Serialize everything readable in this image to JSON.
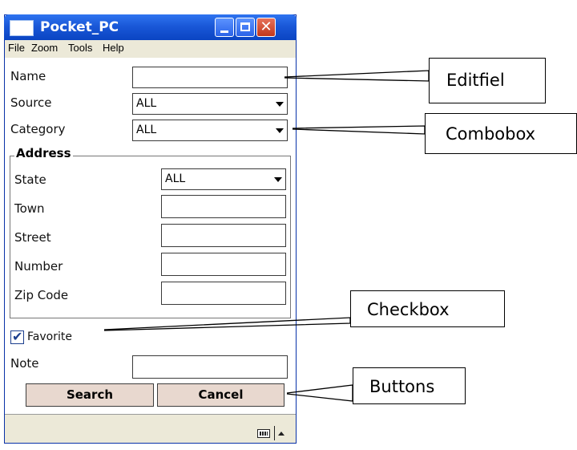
{
  "window": {
    "title": "Pocket_PC",
    "close_glyph": "✕"
  },
  "menu": [
    "File",
    "Zoom",
    "Tools",
    "Help"
  ],
  "form": {
    "name_label": "Name",
    "name_value": "",
    "source_label": "Source",
    "source_value": "ALL",
    "category_label": "Category",
    "category_value": "ALL",
    "address_legend": "Address",
    "state_label": "State",
    "state_value": "ALL",
    "town_label": "Town",
    "town_value": "",
    "street_label": "Street",
    "street_value": "",
    "number_label": "Number",
    "number_value": "",
    "zip_label": "Zip Code",
    "zip_value": "",
    "favorite_label": "Favorite",
    "favorite_checked": true,
    "check_glyph": "✔",
    "note_label": "Note",
    "note_value": ""
  },
  "buttons": {
    "search": "Search",
    "cancel": "Cancel"
  },
  "callouts": {
    "editfield": "Editfiel",
    "combobox": "Combobox",
    "checkbox": "Checkbox",
    "buttons": "Buttons"
  },
  "icons": [
    "app-window-icon",
    "minimize-icon",
    "maximize-icon",
    "close-icon",
    "dropdown-arrow-icon",
    "check-icon",
    "keyboard-icon",
    "sip-up-arrow-icon"
  ]
}
